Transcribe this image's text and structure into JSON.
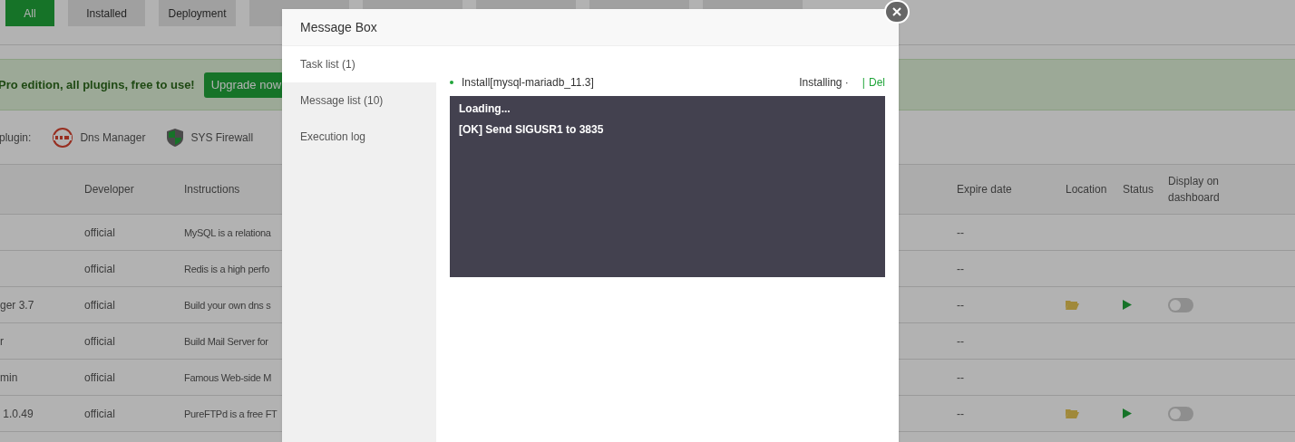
{
  "filter_tabs": [
    {
      "label": "All",
      "selected": true
    },
    {
      "label": "Installed",
      "selected": false
    },
    {
      "label": "Deployment",
      "selected": false
    }
  ],
  "banner": {
    "text": "Pro edition, all plugins, free to use!",
    "button": "Upgrade now"
  },
  "recommend": {
    "label": "plugin:",
    "items": [
      {
        "kind": "dns",
        "label": "Dns Manager"
      },
      {
        "kind": "shield",
        "label": "SYS Firewall"
      }
    ]
  },
  "table": {
    "columns": [
      "Developer",
      "Instructions",
      "Expire date",
      "Location",
      "Status",
      "Display on dashboard"
    ],
    "rows": [
      {
        "name": "",
        "developer": "official",
        "instructions": "MySQL is a relationa",
        "expire": "--",
        "kind": "software"
      },
      {
        "name": "",
        "developer": "official",
        "instructions": "Redis is a high perfo",
        "expire": "--",
        "kind": "software"
      },
      {
        "name": "ger 3.7",
        "developer": "official",
        "instructions": "Build your own dns s",
        "expire": "--",
        "kind": "plugin",
        "dashboard_on": false
      },
      {
        "name": "r",
        "developer": "official",
        "instructions": "Build Mail Server for",
        "expire": "--",
        "kind": "software"
      },
      {
        "name": "min",
        "developer": "official",
        "instructions": "Famous Web-side M",
        "expire": "--",
        "kind": "software"
      },
      {
        "name": " 1.0.49",
        "developer": "official",
        "instructions": "PureFTPd is a free FT",
        "expire": "--",
        "kind": "plugin",
        "dashboard_on": false
      }
    ]
  },
  "modal": {
    "title": "Message Box",
    "nav": [
      {
        "label": "Task list (1)",
        "selected": true
      },
      {
        "label": "Message list (10)",
        "selected": false
      },
      {
        "label": "Execution log",
        "selected": false
      }
    ],
    "task": {
      "name": "Install[mysql-mariadb_11.3]",
      "status": "Installing ·",
      "separator": "|",
      "action": "Del"
    },
    "console": [
      "Loading...",
      "[OK] Send SIGUSR1 to 3835"
    ]
  }
}
